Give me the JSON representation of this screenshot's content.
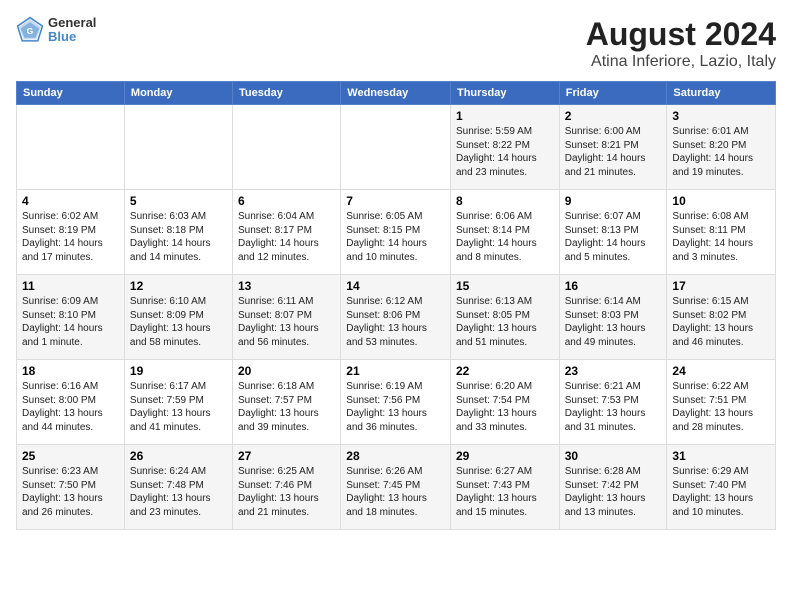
{
  "logo": {
    "line1": "General",
    "line2": "Blue"
  },
  "title": "August 2024",
  "subtitle": "Atina Inferiore, Lazio, Italy",
  "days_of_week": [
    "Sunday",
    "Monday",
    "Tuesday",
    "Wednesday",
    "Thursday",
    "Friday",
    "Saturday"
  ],
  "weeks": [
    [
      {
        "day": "",
        "content": ""
      },
      {
        "day": "",
        "content": ""
      },
      {
        "day": "",
        "content": ""
      },
      {
        "day": "",
        "content": ""
      },
      {
        "day": "1",
        "content": "Sunrise: 5:59 AM\nSunset: 8:22 PM\nDaylight: 14 hours and 23 minutes."
      },
      {
        "day": "2",
        "content": "Sunrise: 6:00 AM\nSunset: 8:21 PM\nDaylight: 14 hours and 21 minutes."
      },
      {
        "day": "3",
        "content": "Sunrise: 6:01 AM\nSunset: 8:20 PM\nDaylight: 14 hours and 19 minutes."
      }
    ],
    [
      {
        "day": "4",
        "content": "Sunrise: 6:02 AM\nSunset: 8:19 PM\nDaylight: 14 hours and 17 minutes."
      },
      {
        "day": "5",
        "content": "Sunrise: 6:03 AM\nSunset: 8:18 PM\nDaylight: 14 hours and 14 minutes."
      },
      {
        "day": "6",
        "content": "Sunrise: 6:04 AM\nSunset: 8:17 PM\nDaylight: 14 hours and 12 minutes."
      },
      {
        "day": "7",
        "content": "Sunrise: 6:05 AM\nSunset: 8:15 PM\nDaylight: 14 hours and 10 minutes."
      },
      {
        "day": "8",
        "content": "Sunrise: 6:06 AM\nSunset: 8:14 PM\nDaylight: 14 hours and 8 minutes."
      },
      {
        "day": "9",
        "content": "Sunrise: 6:07 AM\nSunset: 8:13 PM\nDaylight: 14 hours and 5 minutes."
      },
      {
        "day": "10",
        "content": "Sunrise: 6:08 AM\nSunset: 8:11 PM\nDaylight: 14 hours and 3 minutes."
      }
    ],
    [
      {
        "day": "11",
        "content": "Sunrise: 6:09 AM\nSunset: 8:10 PM\nDaylight: 14 hours and 1 minute."
      },
      {
        "day": "12",
        "content": "Sunrise: 6:10 AM\nSunset: 8:09 PM\nDaylight: 13 hours and 58 minutes."
      },
      {
        "day": "13",
        "content": "Sunrise: 6:11 AM\nSunset: 8:07 PM\nDaylight: 13 hours and 56 minutes."
      },
      {
        "day": "14",
        "content": "Sunrise: 6:12 AM\nSunset: 8:06 PM\nDaylight: 13 hours and 53 minutes."
      },
      {
        "day": "15",
        "content": "Sunrise: 6:13 AM\nSunset: 8:05 PM\nDaylight: 13 hours and 51 minutes."
      },
      {
        "day": "16",
        "content": "Sunrise: 6:14 AM\nSunset: 8:03 PM\nDaylight: 13 hours and 49 minutes."
      },
      {
        "day": "17",
        "content": "Sunrise: 6:15 AM\nSunset: 8:02 PM\nDaylight: 13 hours and 46 minutes."
      }
    ],
    [
      {
        "day": "18",
        "content": "Sunrise: 6:16 AM\nSunset: 8:00 PM\nDaylight: 13 hours and 44 minutes."
      },
      {
        "day": "19",
        "content": "Sunrise: 6:17 AM\nSunset: 7:59 PM\nDaylight: 13 hours and 41 minutes."
      },
      {
        "day": "20",
        "content": "Sunrise: 6:18 AM\nSunset: 7:57 PM\nDaylight: 13 hours and 39 minutes."
      },
      {
        "day": "21",
        "content": "Sunrise: 6:19 AM\nSunset: 7:56 PM\nDaylight: 13 hours and 36 minutes."
      },
      {
        "day": "22",
        "content": "Sunrise: 6:20 AM\nSunset: 7:54 PM\nDaylight: 13 hours and 33 minutes."
      },
      {
        "day": "23",
        "content": "Sunrise: 6:21 AM\nSunset: 7:53 PM\nDaylight: 13 hours and 31 minutes."
      },
      {
        "day": "24",
        "content": "Sunrise: 6:22 AM\nSunset: 7:51 PM\nDaylight: 13 hours and 28 minutes."
      }
    ],
    [
      {
        "day": "25",
        "content": "Sunrise: 6:23 AM\nSunset: 7:50 PM\nDaylight: 13 hours and 26 minutes."
      },
      {
        "day": "26",
        "content": "Sunrise: 6:24 AM\nSunset: 7:48 PM\nDaylight: 13 hours and 23 minutes."
      },
      {
        "day": "27",
        "content": "Sunrise: 6:25 AM\nSunset: 7:46 PM\nDaylight: 13 hours and 21 minutes."
      },
      {
        "day": "28",
        "content": "Sunrise: 6:26 AM\nSunset: 7:45 PM\nDaylight: 13 hours and 18 minutes."
      },
      {
        "day": "29",
        "content": "Sunrise: 6:27 AM\nSunset: 7:43 PM\nDaylight: 13 hours and 15 minutes."
      },
      {
        "day": "30",
        "content": "Sunrise: 6:28 AM\nSunset: 7:42 PM\nDaylight: 13 hours and 13 minutes."
      },
      {
        "day": "31",
        "content": "Sunrise: 6:29 AM\nSunset: 7:40 PM\nDaylight: 13 hours and 10 minutes."
      }
    ]
  ]
}
